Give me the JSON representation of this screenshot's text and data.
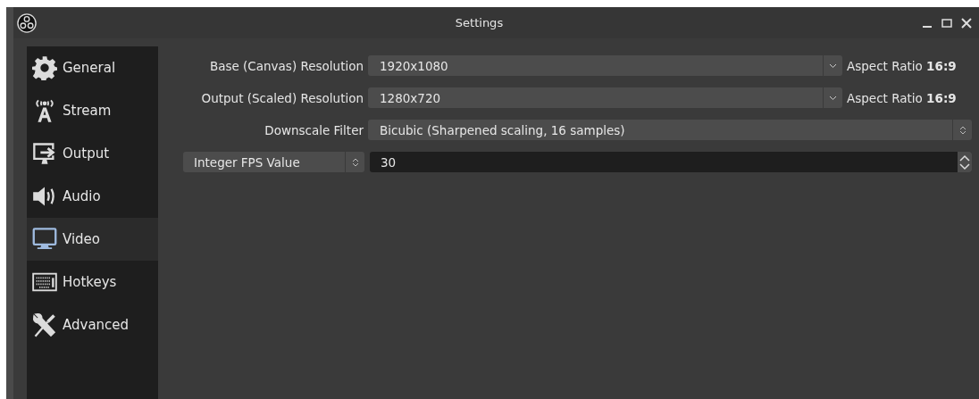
{
  "window": {
    "title": "Settings"
  },
  "sidebar": {
    "items": [
      {
        "label": "General",
        "kind": "gear",
        "selected": false
      },
      {
        "label": "Stream",
        "kind": "antenna",
        "selected": false
      },
      {
        "label": "Output",
        "kind": "output",
        "selected": false
      },
      {
        "label": "Audio",
        "kind": "speaker",
        "selected": false
      },
      {
        "label": "Video",
        "kind": "monitor",
        "selected": true
      },
      {
        "label": "Hotkeys",
        "kind": "keyboard",
        "selected": false
      },
      {
        "label": "Advanced",
        "kind": "tools",
        "selected": false
      }
    ]
  },
  "video": {
    "rows": [
      {
        "kind": "combo",
        "label": "Base (Canvas) Resolution",
        "value": "1920x1080",
        "aspect_label": "Aspect Ratio",
        "aspect_value": "16:9"
      },
      {
        "kind": "combo",
        "label": "Output (Scaled) Resolution",
        "value": "1280x720",
        "aspect_label": "Aspect Ratio",
        "aspect_value": "16:9"
      },
      {
        "kind": "select",
        "label": "Downscale Filter",
        "value": "Bicubic (Sharpened scaling, 16 samples)"
      },
      {
        "kind": "spin",
        "selector": "Integer FPS Value",
        "value": "30"
      }
    ]
  }
}
